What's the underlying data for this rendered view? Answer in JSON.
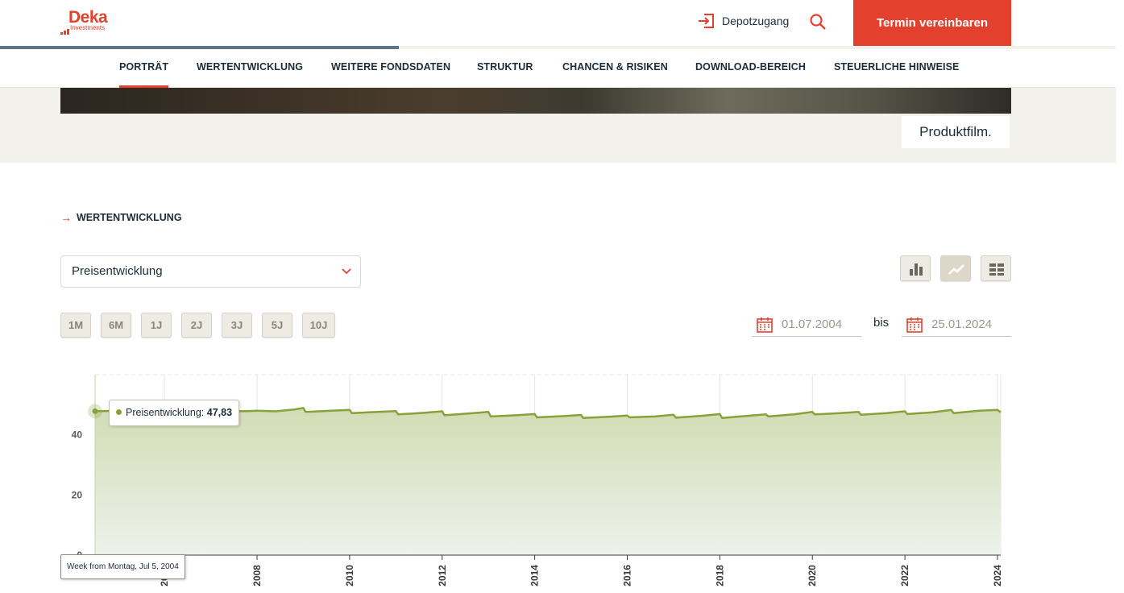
{
  "header": {
    "logo_name": "Deka",
    "logo_sub": "Investments",
    "depot_label": "Depotzugang",
    "cta_label": "Termin vereinbaren"
  },
  "nav": {
    "items": [
      "PORTRÄT",
      "WERTENTWICKLUNG",
      "WEITERE FONDSDATEN",
      "STRUKTUR",
      "CHANCEN & RISIKEN",
      "DOWNLOAD-BEREICH",
      "STEUERLICHE HINWEISE"
    ],
    "active": "PORTRÄT"
  },
  "hero": {
    "film_label": "Produktfilm."
  },
  "section": {
    "title": "WERTENTWICKLUNG",
    "select_value": "Preisentwicklung",
    "ranges": [
      "1M",
      "6M",
      "1J",
      "2J",
      "3J",
      "5J",
      "10J"
    ],
    "date_from": "01.07.2004",
    "date_sep": "bis",
    "date_to": "25.01.2024"
  },
  "tooltip": {
    "series_label": "Preisentwicklung:",
    "value": "47,83",
    "x_label": "Week from Montag, Jul 5, 2004"
  },
  "colors": {
    "accent": "#e3412e",
    "series": "#88a23a",
    "navy": "#1c2c3a"
  },
  "chart_data": {
    "type": "area",
    "series": [
      {
        "name": "Preisentwicklung",
        "x": [
          2004.5,
          2005.0,
          2005.8,
          2006.3,
          2006.7,
          2007.0,
          2007.4,
          2007.8,
          2008.0,
          2008.4,
          2008.8,
          2009.0,
          2009.05,
          2009.6,
          2010.0,
          2010.05,
          2010.6,
          2011.0,
          2011.05,
          2011.6,
          2012.0,
          2012.05,
          2012.5,
          2013.0,
          2013.05,
          2013.6,
          2014.0,
          2014.05,
          2014.6,
          2015.0,
          2015.05,
          2015.6,
          2016.0,
          2016.05,
          2016.6,
          2017.0,
          2017.05,
          2017.6,
          2018.0,
          2018.05,
          2018.6,
          2019.0,
          2019.05,
          2019.6,
          2020.0,
          2020.05,
          2020.6,
          2021.0,
          2021.05,
          2021.6,
          2022.0,
          2022.05,
          2022.6,
          2023.0,
          2023.05,
          2023.6,
          2024.0,
          2024.07
        ],
        "values": [
          47.83,
          48.0,
          47.0,
          47.6,
          46.9,
          47.5,
          47.8,
          47.9,
          48.0,
          47.8,
          48.4,
          48.9,
          47.6,
          48.0,
          48.3,
          47.2,
          47.6,
          47.9,
          46.8,
          47.3,
          47.8,
          46.5,
          47.0,
          47.6,
          46.1,
          46.5,
          46.9,
          45.8,
          46.2,
          46.6,
          45.6,
          46.0,
          46.4,
          45.8,
          46.1,
          46.7,
          45.7,
          46.3,
          46.9,
          45.6,
          46.3,
          46.8,
          46.1,
          46.8,
          47.6,
          46.8,
          47.2,
          47.6,
          46.7,
          47.2,
          47.8,
          46.9,
          47.5,
          48.3,
          47.2,
          48.0,
          48.3,
          47.5
        ]
      }
    ],
    "x_ticks": [
      "2006",
      "2008",
      "2010",
      "2012",
      "2014",
      "2016",
      "2018",
      "2020",
      "2022",
      "2024"
    ],
    "y_ticks": [
      "0",
      "20",
      "40"
    ],
    "xlim": [
      2004.5,
      2024.07
    ],
    "ylim": [
      0,
      60
    ],
    "grid": true
  }
}
